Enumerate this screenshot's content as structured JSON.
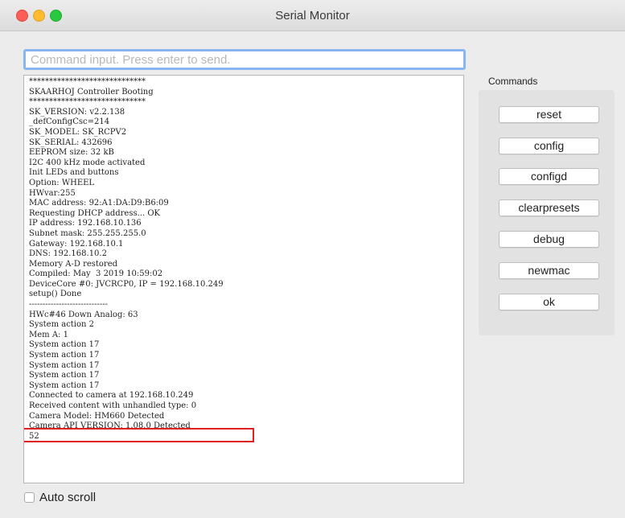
{
  "window": {
    "title": "Serial Monitor"
  },
  "command_input": {
    "placeholder": "Command input. Press enter to send."
  },
  "log": {
    "lines": [
      "*****************************",
      "SKAARHOJ Controller Booting",
      "*****************************",
      "SK_VERSION: v2.2.138",
      "_defConfigCsc=214",
      "SK_MODEL: SK_RCPV2",
      "SK_SERIAL: 432696",
      "EEPROM size: 32 kB",
      "I2C 400 kHz mode activated",
      "Init LEDs and buttons",
      "Option: WHEEL",
      "HWvar:255",
      "MAC address: 92:A1:DA:D9:B6:09",
      "Requesting DHCP address... OK",
      "IP address: 192.168.10.136",
      "Subnet mask: 255.255.255.0",
      "Gateway: 192.168.10.1",
      "DNS: 192.168.10.2",
      "Memory A-D restored",
      "Compiled: May  3 2019 10:59:02",
      "DeviceCore #0: JVCRCP0, IP = 192.168.10.249",
      "setup() Done",
      "-----------------------------",
      "HWc#46 Down Analog: 63",
      "System action 2",
      "Mem A: 1",
      "System action 17",
      "System action 17",
      "System action 17",
      "System action 17",
      "System action 17",
      "Connected to camera at 192.168.10.249",
      "Received content with unhandled type: 0",
      "Camera Model: HM660 Detected",
      "Camera API VERSION: 1.08.0 Detected",
      "52"
    ]
  },
  "commands": {
    "label": "Commands",
    "buttons": [
      {
        "id": "reset",
        "label": "reset"
      },
      {
        "id": "config",
        "label": "config"
      },
      {
        "id": "configd",
        "label": "configd"
      },
      {
        "id": "clearpresets",
        "label": "clearpresets"
      },
      {
        "id": "debug",
        "label": "debug"
      },
      {
        "id": "newmac",
        "label": "newmac"
      },
      {
        "id": "ok",
        "label": "ok"
      }
    ]
  },
  "autoscroll": {
    "label": "Auto scroll",
    "checked": false
  }
}
